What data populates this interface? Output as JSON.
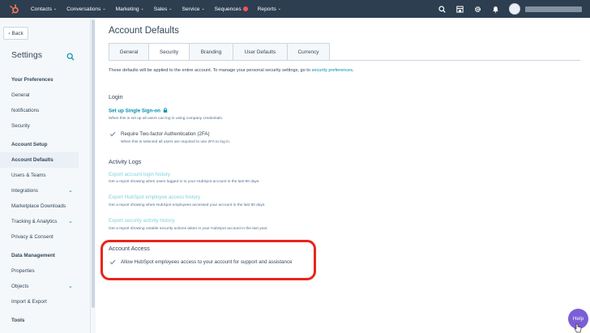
{
  "nav": {
    "items": [
      {
        "label": "Contacts"
      },
      {
        "label": "Conversations"
      },
      {
        "label": "Marketing"
      },
      {
        "label": "Sales"
      },
      {
        "label": "Service"
      },
      {
        "label": "Sequences"
      },
      {
        "label": "Reports"
      }
    ]
  },
  "sidebar": {
    "back_label": "Back",
    "title": "Settings",
    "preferences_heading": "Your Preferences",
    "preferences": [
      "General",
      "Notifications",
      "Security"
    ],
    "account_heading": "Account Setup",
    "account": [
      "Account Defaults",
      "Users & Teams",
      "Integrations",
      "Marketplace Downloads",
      "Tracking & Analytics",
      "Privacy & Consent"
    ],
    "data_heading": "Data Management",
    "data": [
      "Properties",
      "Objects",
      "Import & Export"
    ],
    "tools_heading": "Tools"
  },
  "main": {
    "title": "Account Defaults",
    "tabs": [
      "General",
      "Security",
      "Branding",
      "User Defaults",
      "Currency"
    ],
    "intro_text": "These defaults will be applied to the entire account. To manage your personal security settings, go to ",
    "intro_link": "security preferences",
    "intro_end": ".",
    "login": {
      "heading": "Login",
      "sso_link": "Set up Single Sign-on",
      "sso_desc": "When this is set up all users can log in using company credentials.",
      "twofa_label": "Require Two-factor Authentication (2FA)",
      "twofa_desc": "When this is selected all users are required to use 2FA to log in."
    },
    "activity": {
      "heading": "Activity Logs",
      "items": [
        {
          "link": "Export account login history",
          "desc": "Get a report showing when users logged in to your HubSpot account in the last 90 days."
        },
        {
          "link": "Export HubSpot employee access history",
          "desc": "Get a report showing when HubSpot employees accessed your account in the last 90 days."
        },
        {
          "link": "Export security activity history",
          "desc": "Get a report showing notable security actions taken in your HubSpot account in the last year."
        }
      ]
    },
    "access": {
      "heading": "Account Access",
      "checkbox_label": "Allow HubSpot employees access to your account for support and assistance"
    }
  },
  "help_label": "Help",
  "colors": {
    "nav_bg": "#2d3e50",
    "link": "#0091ae",
    "accent_orange": "#ff7a59",
    "highlight_red": "#e8251c",
    "help_purple": "#7b5ed6"
  }
}
